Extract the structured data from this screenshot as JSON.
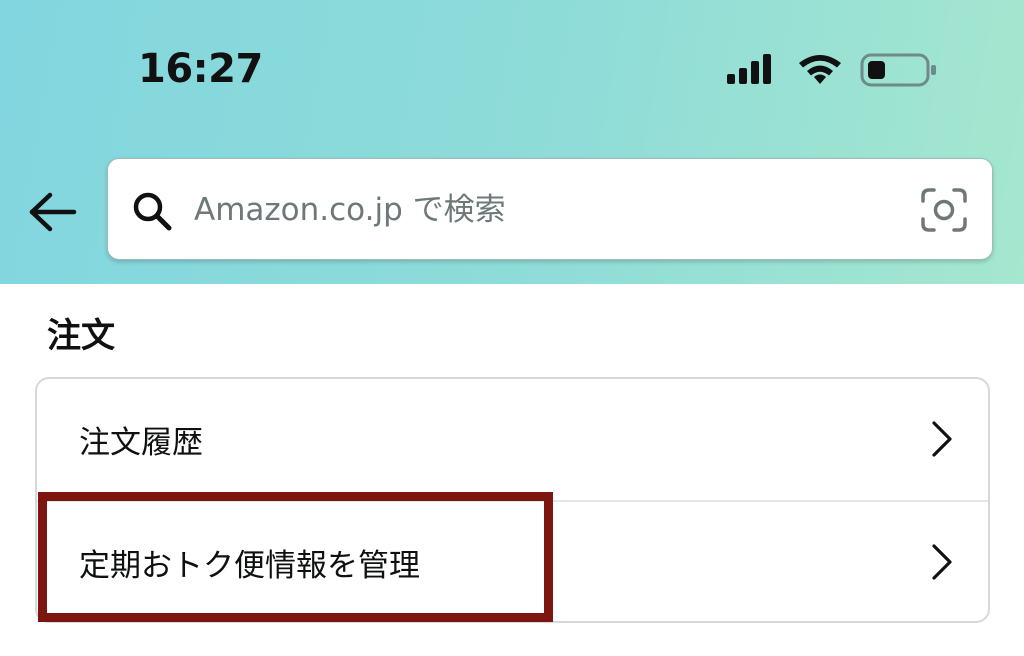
{
  "status_bar": {
    "time": "16:27",
    "icons": [
      "cellular-signal-icon",
      "wifi-icon",
      "battery-icon"
    ]
  },
  "header": {
    "gradient_colors": [
      "#82d6df",
      "#a5e7cf"
    ],
    "back_icon": "back-arrow-icon"
  },
  "search": {
    "placeholder": "Amazon.co.jp で検索",
    "value": "",
    "search_icon": "search-icon",
    "camera_icon": "camera-scan-icon"
  },
  "orders_section": {
    "title": "注文",
    "items": [
      {
        "label": "注文履歴",
        "icon": "chevron-right-icon"
      },
      {
        "label": "定期おトク便情報を管理",
        "icon": "chevron-right-icon"
      }
    ]
  },
  "annotation": {
    "highlight_color": "#7d1510",
    "highlighted_item": "定期おトク便情報を管理"
  }
}
